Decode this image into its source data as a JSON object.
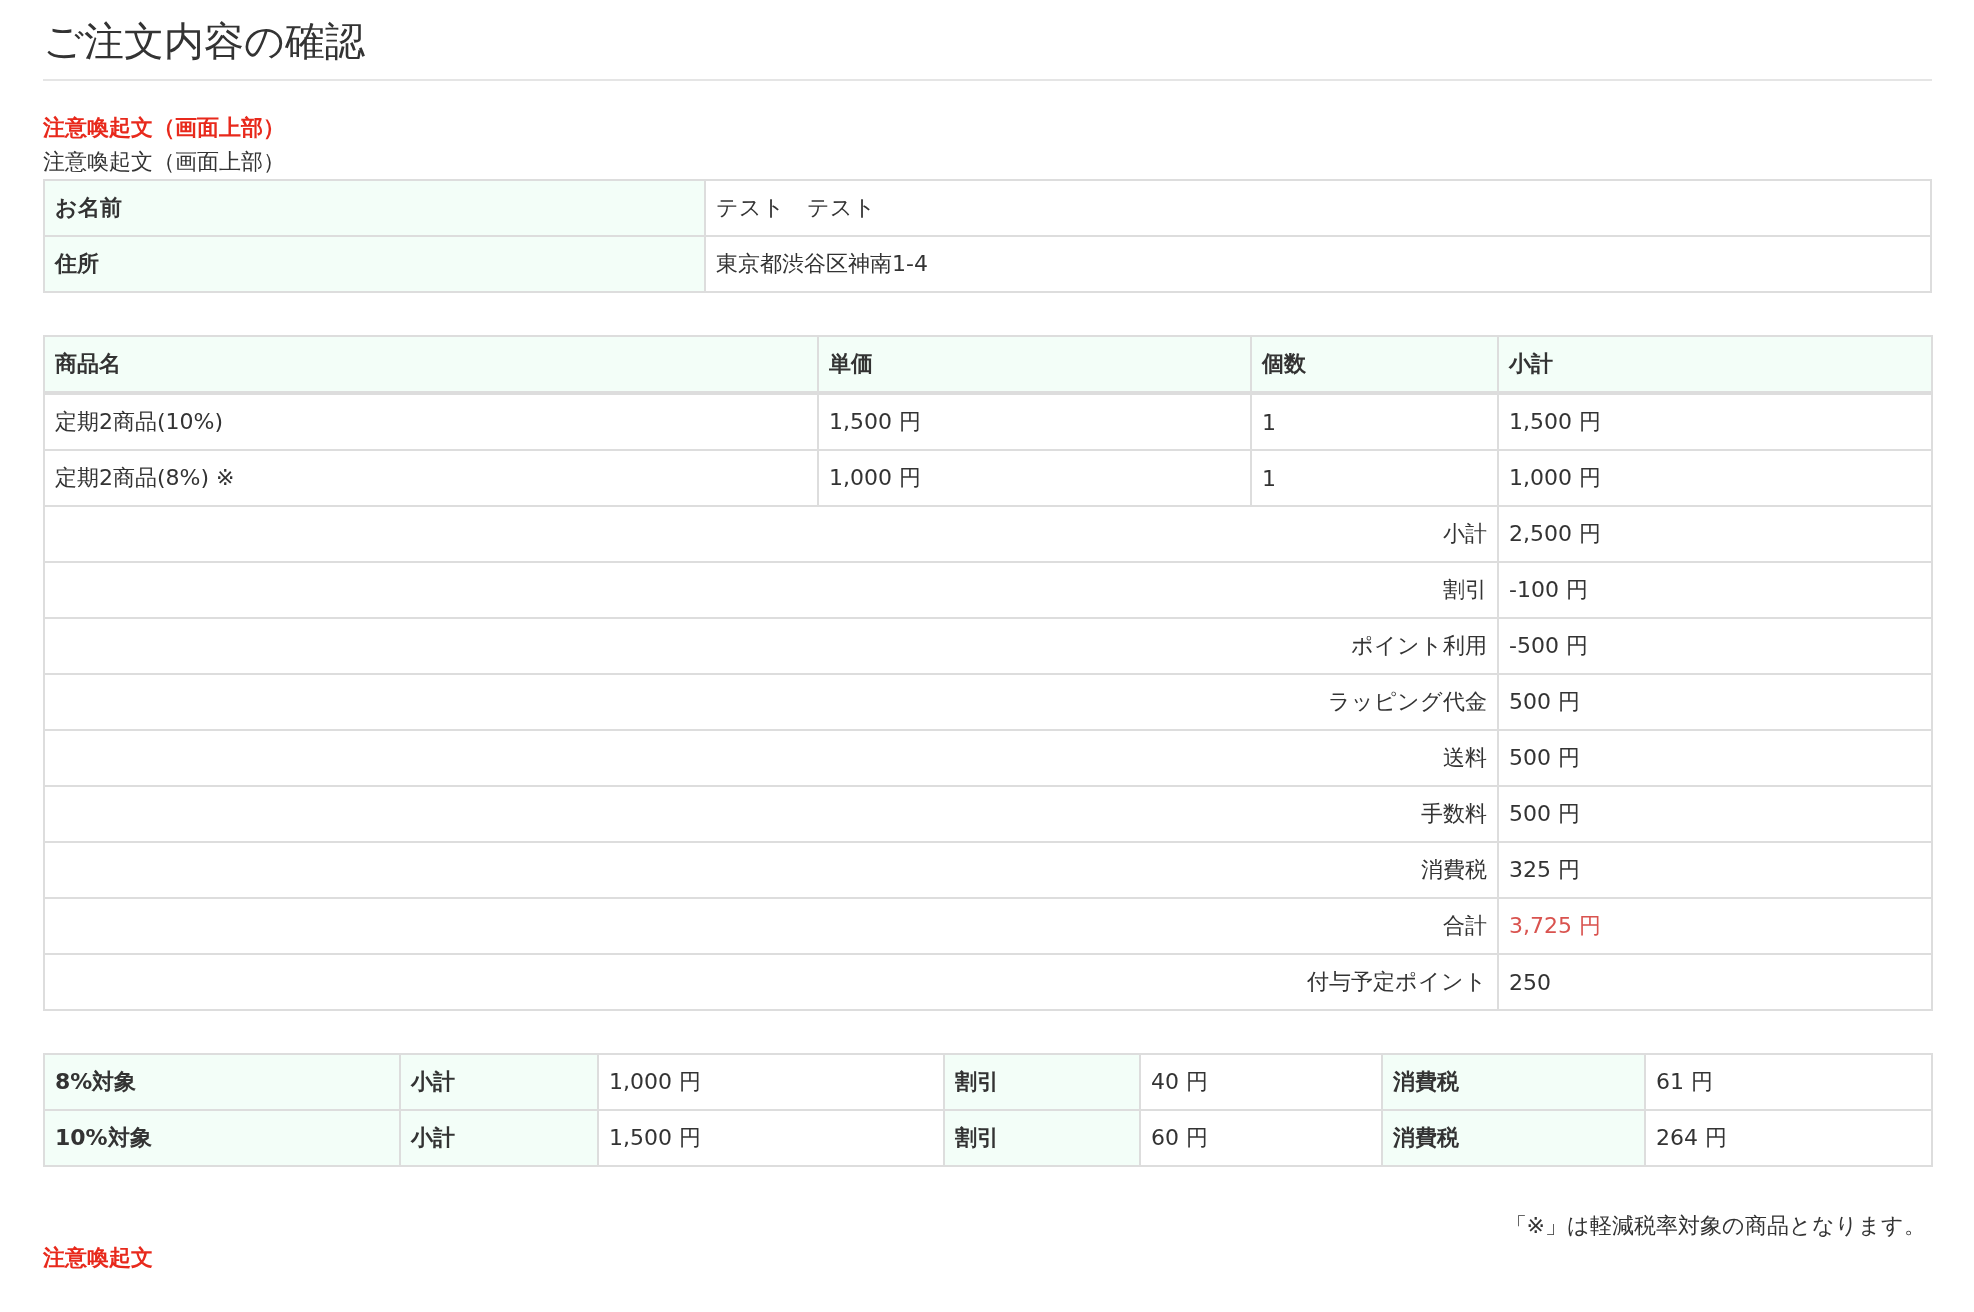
{
  "title": "ご注文内容の確認",
  "notice_top": {
    "emphasis": "注意喚起文（画面上部）",
    "text": "注意喚起文（画面上部）"
  },
  "customer": [
    {
      "label": "お名前",
      "value": "テスト　テスト"
    },
    {
      "label": "住所",
      "value": "東京都渋谷区神南1-4"
    }
  ],
  "items": {
    "columns": [
      "商品名",
      "単価",
      "個数",
      "小計"
    ],
    "rows": [
      [
        "定期2商品(10%)",
        "1,500 円",
        "1",
        "1,500 円"
      ],
      [
        "定期2商品(8%) ※",
        "1,000 円",
        "1",
        "1,000 円"
      ]
    ],
    "summary": [
      {
        "label": "小計",
        "value": "2,500 円",
        "highlight": false
      },
      {
        "label": "割引",
        "value": "-100 円",
        "highlight": false
      },
      {
        "label": "ポイント利用",
        "value": "-500 円",
        "highlight": false
      },
      {
        "label": "ラッピング代金",
        "value": "500 円",
        "highlight": false
      },
      {
        "label": "送料",
        "value": "500 円",
        "highlight": false
      },
      {
        "label": "手数料",
        "value": "500 円",
        "highlight": false
      },
      {
        "label": "消費税",
        "value": "325 円",
        "highlight": false
      },
      {
        "label": "合計",
        "value": "3,725 円",
        "highlight": true
      },
      {
        "label": "付与予定ポイント",
        "value": "250",
        "highlight": false
      }
    ]
  },
  "tax_breakdown": [
    [
      "8%対象",
      "小計",
      "1,000 円",
      "割引",
      "40 円",
      "消費税",
      "61 円"
    ],
    [
      "10%対象",
      "小計",
      "1,500 円",
      "割引",
      "60 円",
      "消費税",
      "264 円"
    ]
  ],
  "footnote": "「※」は軽減税率対象の商品となります。",
  "notice_bottom": "注意喚起文"
}
